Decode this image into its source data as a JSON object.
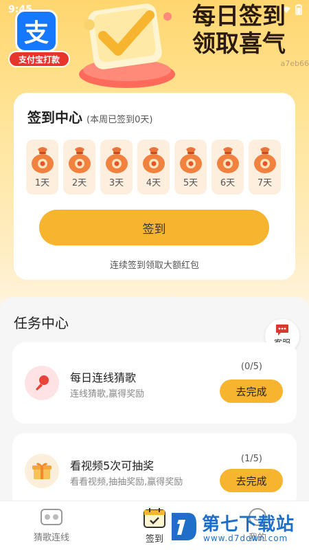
{
  "status_bar": {
    "time": "9:45"
  },
  "banner": {
    "logo_char": "支",
    "logo_badge": "支付宝打款",
    "title_line1": "每日签到",
    "title_line2": "领取喜气",
    "id_text": "a7eb66"
  },
  "sign_center": {
    "title": "签到中心",
    "subtitle": "(本周已签到0天)",
    "days": [
      {
        "label": "1天"
      },
      {
        "label": "2天"
      },
      {
        "label": "3天"
      },
      {
        "label": "4天"
      },
      {
        "label": "5天"
      },
      {
        "label": "6天"
      },
      {
        "label": "7天"
      }
    ],
    "button_label": "签到",
    "hint": "连续签到领取大额红包"
  },
  "task_center": {
    "title": "任务中心",
    "support_label": "客服",
    "tasks": [
      {
        "name": "每日连线猜歌",
        "desc": "连线猜歌,赢得奖励",
        "progress": "(0/5)",
        "button": "去完成",
        "icon": "microphone-icon"
      },
      {
        "name": "看视频5次可抽奖",
        "desc": "看看视频,抽抽奖励,赢得奖励",
        "progress": "(1/5)",
        "button": "去完成",
        "icon": "gift-icon"
      }
    ]
  },
  "bottom_nav": {
    "items": [
      {
        "label": "猜歌连线",
        "icon": "game-icon"
      },
      {
        "label": "签到",
        "icon": "calendar-check-icon",
        "active": true
      },
      {
        "label": "我的",
        "icon": "profile-icon"
      }
    ]
  },
  "site_watermark": {
    "name": "第七下载站",
    "url": "www.d7down.com"
  },
  "colors": {
    "accent": "#f7b52f",
    "brand_blue": "#1677ff",
    "card_tint": "#fdeede"
  }
}
